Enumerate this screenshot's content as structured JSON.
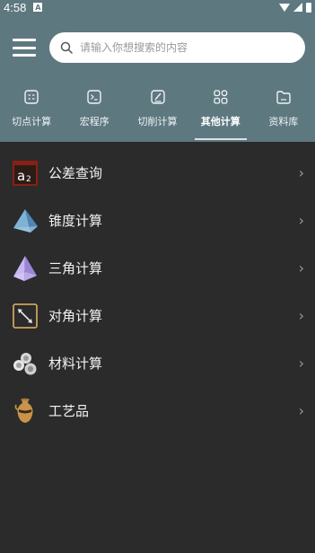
{
  "status_bar": {
    "time": "4:58",
    "notification_letter": "A"
  },
  "search": {
    "placeholder": "请输入你想搜索的内容"
  },
  "tabs": [
    {
      "label": "切点计算",
      "icon": "calculator-icon"
    },
    {
      "label": "宏程序",
      "icon": "terminal-icon"
    },
    {
      "label": "切削计算",
      "icon": "edit-note-icon"
    },
    {
      "label": "其他计算",
      "icon": "grid-icon",
      "active": true
    },
    {
      "label": "资料库",
      "icon": "folder-icon"
    }
  ],
  "items": [
    {
      "label": "公差查询",
      "icon": "tolerance-icon"
    },
    {
      "label": "锥度计算",
      "icon": "cone-icon"
    },
    {
      "label": "三角计算",
      "icon": "pyramid-icon"
    },
    {
      "label": "对角计算",
      "icon": "diagonal-icon"
    },
    {
      "label": "材料计算",
      "icon": "material-pipes-icon"
    },
    {
      "label": "工艺品",
      "icon": "vase-icon"
    }
  ],
  "chevron": "›",
  "colors": {
    "header": "#5e7880",
    "background": "#2b2b2b"
  }
}
